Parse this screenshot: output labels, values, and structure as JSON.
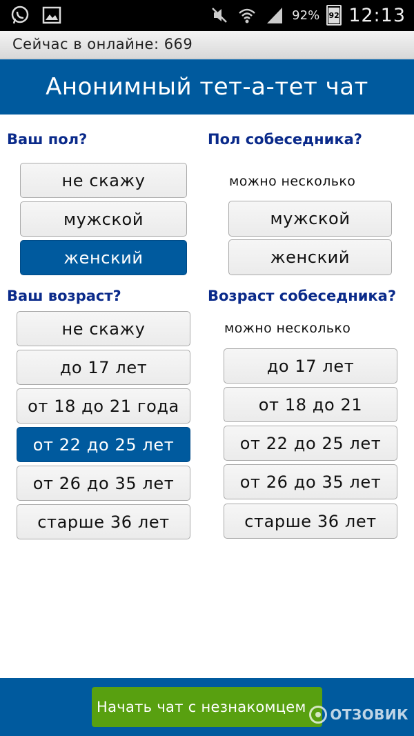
{
  "status_bar": {
    "battery_percent_text": "92%",
    "battery_level": "92",
    "time": "12:13",
    "icons_left": [
      "whatsapp-icon",
      "gallery-icon"
    ],
    "icons_right": [
      "mute-icon",
      "wifi-icon",
      "signal-icon",
      "battery-icon"
    ]
  },
  "online": {
    "text": "Сейчас в онлайне: 669"
  },
  "header": {
    "title": "Анонимный тет-а-тет чат"
  },
  "your_gender": {
    "label": "Ваш пол?",
    "options": [
      "не скажу",
      "мужской",
      "женский"
    ],
    "selected": "женский"
  },
  "partner_gender": {
    "label": "Пол собеседника?",
    "hint": "можно несколько",
    "options": [
      "мужской",
      "женский"
    ]
  },
  "your_age": {
    "label": "Ваш возраст?",
    "options": [
      "не скажу",
      "до 17 лет",
      "от 18 до 21 года",
      "от 22 до 25 лет",
      "от 26 до 35 лет",
      "старше 36 лет"
    ],
    "selected": "от 22 до 25 лет"
  },
  "partner_age": {
    "label": "Возраст собеседника?",
    "hint": "можно несколько",
    "options": [
      "до 17 лет",
      "от 18 до 21",
      "от 22 до 25 лет",
      "от 26 до 35 лет",
      "старше 36 лет"
    ]
  },
  "footer": {
    "start_button": "Начать чат с незнакомцем",
    "watermark": "ОТЗОВИК"
  },
  "colors": {
    "accent": "#005a9e",
    "start_button": "#58a010",
    "label": "#0a2a8a"
  }
}
